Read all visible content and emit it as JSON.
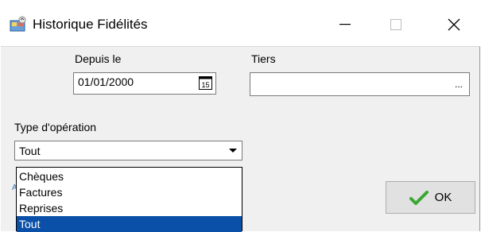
{
  "window": {
    "title": "Historique Fidélités"
  },
  "form": {
    "depuis_label": "Depuis le",
    "depuis_value": "01/01/2000",
    "calendar_glyph": "15",
    "tiers_label": "Tiers",
    "tiers_value": "",
    "tiers_button": "...",
    "type_label": "Type d'opération",
    "type_value": "Tout",
    "hint_fragment": "A"
  },
  "dropdown": {
    "options": [
      "Chèques",
      "Factures",
      "Reprises",
      "Tout"
    ],
    "selected": "Tout"
  },
  "actions": {
    "ok_label": "OK"
  },
  "colors": {
    "selection": "#0a50a8",
    "check": "#3aa830",
    "client_bg": "#f0f0f0"
  },
  "icons": [
    "app-icon",
    "minimize-icon",
    "maximize-icon",
    "close-icon",
    "calendar-icon",
    "chevron-down-icon",
    "checkmark-icon"
  ]
}
